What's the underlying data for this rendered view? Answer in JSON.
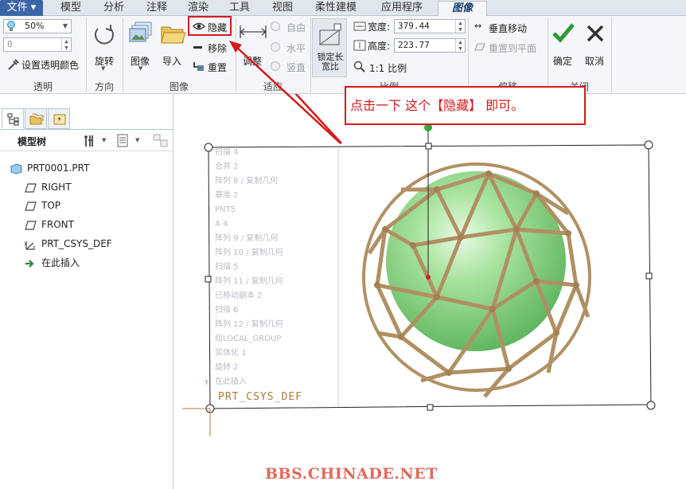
{
  "tabs": [
    {
      "label": "文件 ▾"
    },
    {
      "label": "模型"
    },
    {
      "label": "分析"
    },
    {
      "label": "注释"
    },
    {
      "label": "渲染"
    },
    {
      "label": "工具"
    },
    {
      "label": "视图"
    },
    {
      "label": "柔性建模"
    },
    {
      "label": "应用程序"
    },
    {
      "label": "图像"
    }
  ],
  "ribbon": {
    "transparency": {
      "value": "50%",
      "input_value": "0",
      "set_color_label": "设置透明颜色",
      "group_label": "透明"
    },
    "orientation": {
      "rotate_label": "旋转",
      "group_label": "方向"
    },
    "image": {
      "image_label": "图像",
      "import_label": "导入",
      "hide_label": "隐藏",
      "remove_label": "移除",
      "reset_label": "重置",
      "group_label": "图像"
    },
    "fit": {
      "adjust_label": "调整",
      "free_label": "自由",
      "horizontal_label": "水平",
      "vertical_label": "竖直",
      "group_label": "适应"
    },
    "scale": {
      "lock_ratio_label": "锁定长宽比",
      "width_label": "宽度:",
      "width_value": "379.44",
      "height_label": "高度:",
      "height_value": "223.77",
      "ratio_label": "1:1 比例",
      "group_label": "比例"
    },
    "offset": {
      "vertical_move_label": "垂直移动",
      "reset_plane_label": "重置到平面",
      "group_label": "偏移"
    },
    "close": {
      "ok_label": "确定",
      "cancel_label": "取消",
      "group_label": "关闭"
    }
  },
  "model_tree": {
    "title": "模型树",
    "items": [
      {
        "label": "PRT0001.PRT",
        "icon": "part-icon"
      },
      {
        "label": "RIGHT",
        "icon": "datum-plane-icon"
      },
      {
        "label": "TOP",
        "icon": "datum-plane-icon"
      },
      {
        "label": "FRONT",
        "icon": "datum-plane-icon"
      },
      {
        "label": "PRT_CSYS_DEF",
        "icon": "csys-icon"
      },
      {
        "label": "在此插入",
        "icon": "insert-arrow-icon"
      }
    ]
  },
  "background_image_tree": [
    "扫描 4",
    "合并 2",
    "阵列 8 / 复制几何",
    "基准 2",
    "PNT5",
    "A 4",
    "阵列 9 / 复制几何",
    "阵列 10 / 复制几何",
    "扫描 5",
    "阵列 11 / 复制几何",
    "已移动副本 2",
    "扫描 6",
    "阵列 12 / 复制几何",
    "组LOCAL_GROUP",
    "实体化 1",
    "旋转 2",
    "在此插入"
  ],
  "csys_label": "PRT_CSYS_DEF",
  "callout_text": "点击一下  这个【隐藏】    即可。",
  "watermark": "BBS.CHINADE.NET",
  "colors": {
    "accent": "#d6181e",
    "frame_tan": "#b09063",
    "sphere_green": "#7ccf7a",
    "file_tab": "#3a66a8"
  }
}
